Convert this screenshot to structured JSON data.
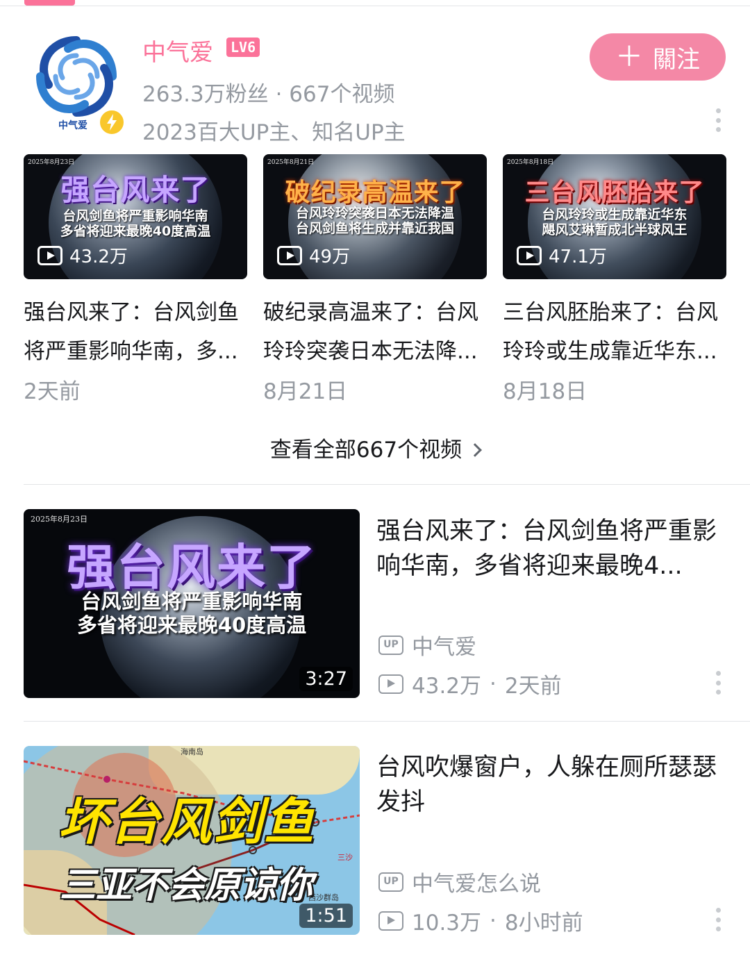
{
  "creator": {
    "name": "中气爱",
    "level": "LV6",
    "stats": "263.3万粉丝 · 667个视频",
    "honor": "2023百大UP主、知名UP主",
    "avatar_brand": "中气爱",
    "follow_label": "關注",
    "follow_icon": "plus-icon"
  },
  "mini_videos": [
    {
      "thumb_date": "2025年8月23日",
      "thumb_headline": "强台风来了",
      "thumb_sub_1": "台风剑鱼将严重影响华南",
      "thumb_sub_2": "多省将迎来最晚40度高温",
      "views": "43.2万",
      "title": "强台风来了：台风剑鱼将严重影响华南，多...",
      "date": "2天前"
    },
    {
      "thumb_date": "2025年8月21日",
      "thumb_headline": "破纪录高温来了",
      "thumb_sub_1": "台风玲玲突袭日本无法降温",
      "thumb_sub_2": "台风剑鱼将生成并靠近我国",
      "views": "49万",
      "title": "破纪录高温来了：台风玲玲突袭日本无法降...",
      "date": "8月21日"
    },
    {
      "thumb_date": "2025年8月18日",
      "thumb_headline": "三台风胚胎来了",
      "thumb_sub_1": "台风玲玲或生成靠近华东",
      "thumb_sub_2": "飓风艾琳暂成北半球风王",
      "views": "47.1万",
      "title": "三台风胚胎来了：台风玲玲或生成靠近华东...",
      "date": "8月18日"
    }
  ],
  "view_all_label": "查看全部667个视频",
  "videos": [
    {
      "thumb_date": "2025年8月23日",
      "thumb_headline": "强台风来了",
      "thumb_sub_1": "台风剑鱼将严重影响华南",
      "thumb_sub_2": "多省将迎来最晚40度高温",
      "duration": "3:27",
      "title": "强台风来了：台风剑鱼将严重影响华南，多省将迎来最晚4...",
      "up_name": "中气爱",
      "views": "43.2万",
      "time": "2天前"
    },
    {
      "thumb_headline": "坏台风剑鱼",
      "thumb_sub": "三亚不会原谅你",
      "map_label_1": "海南岛",
      "map_label_2": "西沙群岛",
      "map_label_3": "三沙",
      "duration": "1:51",
      "title": "台风吹爆窗户，人躲在厕所瑟瑟发抖",
      "up_name": "中气爱怎么说",
      "views": "10.3万",
      "time": "8小时前"
    }
  ],
  "colors": {
    "accent": "#fb7299",
    "follow_bg": "#f488a6",
    "muted_text": "#9499a0",
    "verify_badge": "#f9c72b"
  },
  "icons": {
    "up_badge": "UP",
    "view": "play-icon",
    "more": "more-vertical-icon",
    "chevron": "chevron-right-icon",
    "verify": "lightning-icon"
  }
}
